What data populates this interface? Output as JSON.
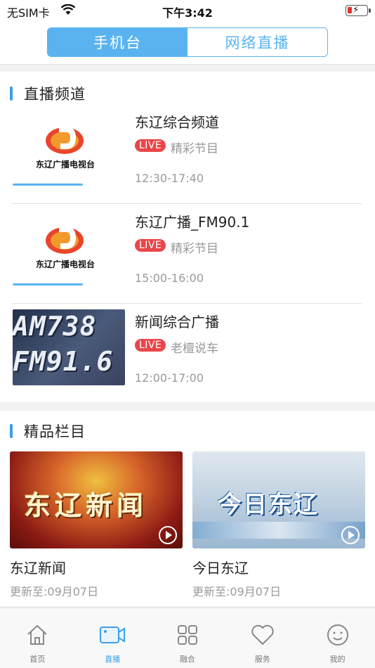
{
  "status_bar": {
    "carrier": "无SIM卡",
    "time": "下午3:42"
  },
  "header": {
    "tabs": [
      {
        "label": "手机台",
        "active": true
      },
      {
        "label": "网络直播",
        "active": false
      }
    ]
  },
  "live_section": {
    "title": "直播频道",
    "channels": [
      {
        "name": "东辽综合频道",
        "badge": "LIVE",
        "program": "精彩节目",
        "time": "12:30-17:40",
        "logo_text": "东辽广播电视台"
      },
      {
        "name": "东辽广播_FM90.1",
        "badge": "LIVE",
        "program": "精彩节目",
        "time": "15:00-16:00",
        "logo_text": "东辽广播电视台"
      },
      {
        "name": "新闻综合广播",
        "badge": "LIVE",
        "program": "老檀说车",
        "time": "12:00-17:00",
        "thumb_lines": [
          "AM738",
          "FM91.6"
        ]
      }
    ]
  },
  "fine_section": {
    "title": "精品栏目",
    "cards": [
      {
        "title": "东辽新闻",
        "updated": "更新至:09月07日",
        "image_text": "东辽新闻"
      },
      {
        "title": "今日东辽",
        "updated": "更新至:09月07日",
        "image_text": "今日东辽"
      }
    ]
  },
  "tabbar": {
    "items": [
      {
        "label": "首页",
        "icon": "home-icon",
        "active": false
      },
      {
        "label": "直播",
        "icon": "video-camera-icon",
        "active": true
      },
      {
        "label": "融合",
        "icon": "grid-icon",
        "active": false
      },
      {
        "label": "服务",
        "icon": "heart-icon",
        "active": false
      },
      {
        "label": "我的",
        "icon": "smiley-icon",
        "active": false
      }
    ]
  },
  "colors": {
    "accent": "#5ab3f0",
    "live": "#e9464a"
  }
}
